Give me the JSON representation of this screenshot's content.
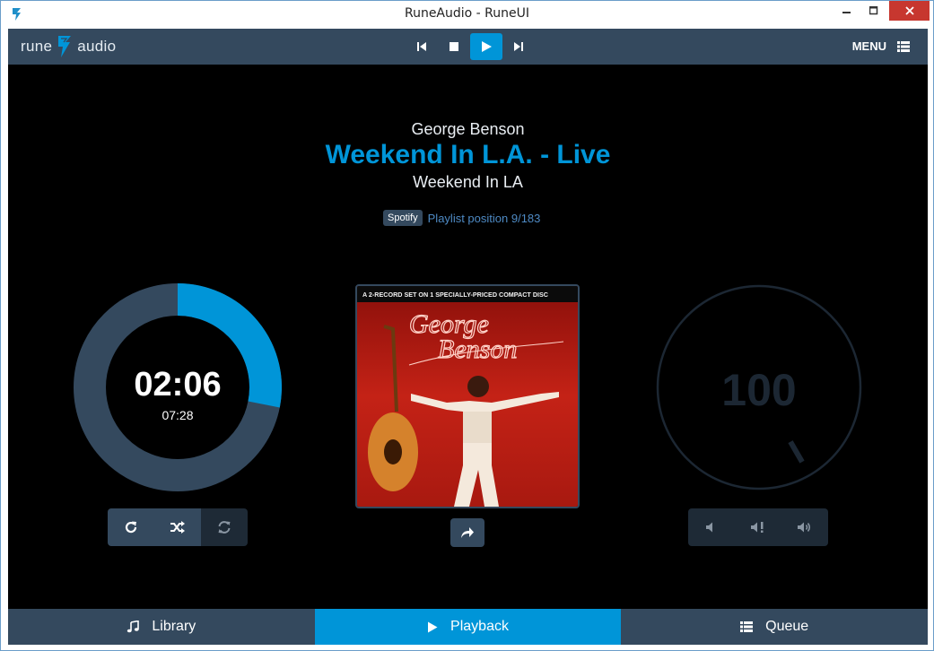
{
  "window": {
    "title": "RuneAudio - RuneUI"
  },
  "topbar": {
    "logo_left": "rune",
    "logo_right": "audio",
    "menu_label": "MENU",
    "transport": [
      {
        "icon": "previous-icon"
      },
      {
        "icon": "stop-icon"
      },
      {
        "icon": "play-icon",
        "active": true
      },
      {
        "icon": "next-icon"
      }
    ]
  },
  "now_playing": {
    "artist": "George Benson",
    "song": "Weekend In L.A. - Live",
    "album": "Weekend In LA",
    "source_badge": "Spotify",
    "playlist_position": "Playlist position 9/183"
  },
  "timer": {
    "elapsed": "02:06",
    "total": "07:28",
    "progress": 0.281
  },
  "playmodes": [
    {
      "icon": "repeat-icon",
      "state": "on"
    },
    {
      "icon": "shuffle-icon",
      "state": "on"
    },
    {
      "icon": "single-repeat-icon",
      "state": "off"
    }
  ],
  "cover": {
    "header_text": "A 2-RECORD SET ON 1 SPECIALLY-PRICED COMPACT DISC",
    "artist_script_1": "George",
    "artist_script_2": "Benson"
  },
  "volume": {
    "value": "100",
    "level": 1.0,
    "buttons": [
      {
        "icon": "volume-down-icon"
      },
      {
        "icon": "mute-icon"
      },
      {
        "icon": "volume-up-icon"
      }
    ]
  },
  "bottom_tabs": [
    {
      "label": "Library",
      "icon": "music-icon",
      "active": false
    },
    {
      "label": "Playback",
      "icon": "play-icon",
      "active": true
    },
    {
      "label": "Queue",
      "icon": "list-icon",
      "active": false
    }
  ],
  "colors": {
    "accent": "#0095d8",
    "panel": "#34495e",
    "background": "#000000"
  }
}
